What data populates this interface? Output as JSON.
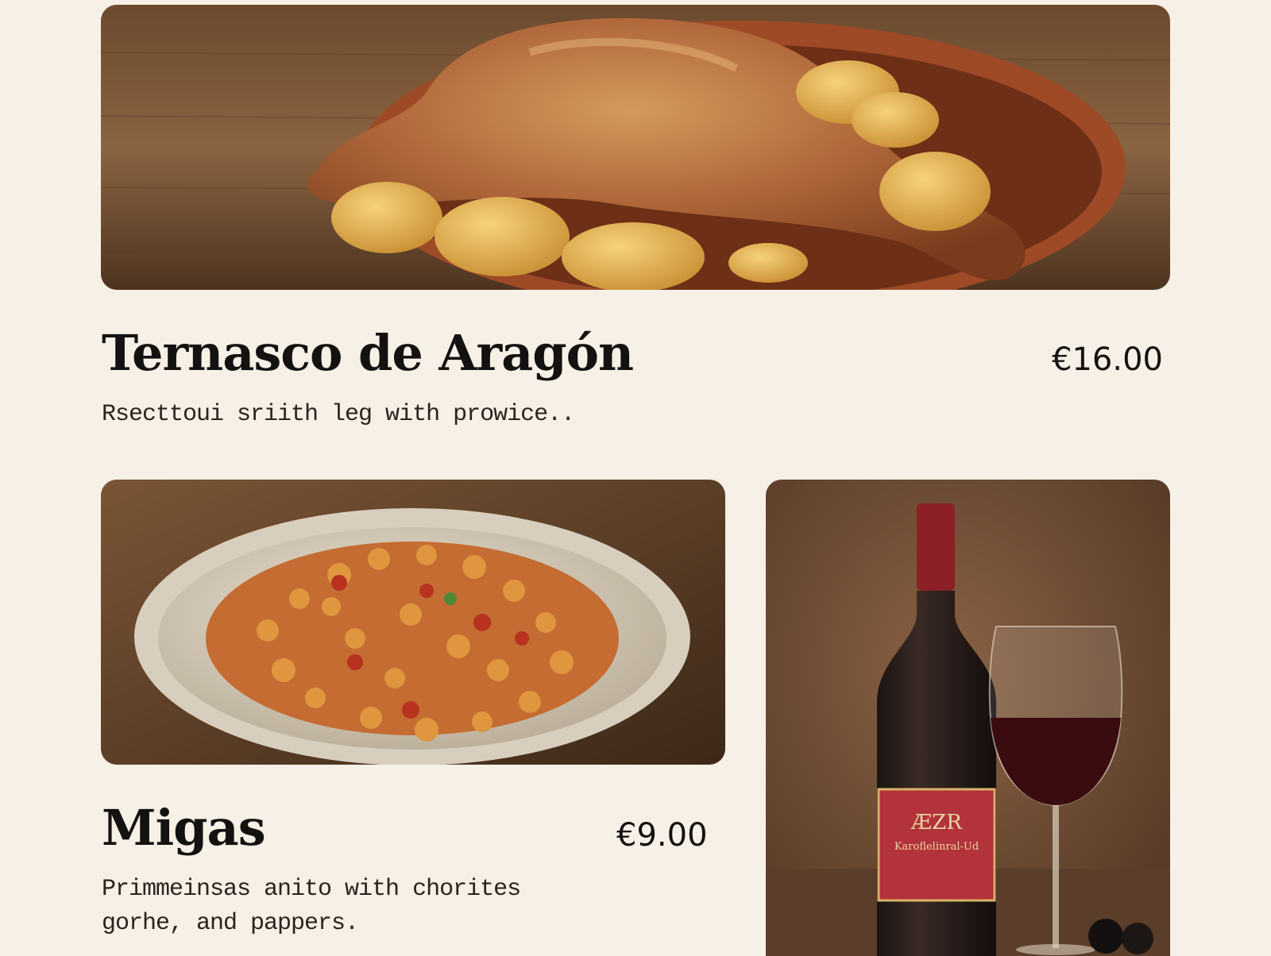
{
  "dishes": [
    {
      "title": "Ternasco de Aragón",
      "price": "€16.00",
      "description": "Rsecttoui sriith leg with prowice..",
      "image": "roast-lamb-leg-with-potatoes-photo"
    },
    {
      "title": "Migas",
      "price": "€9.00",
      "description": "Primmeinsas anito with chorites\ngorhe, and pappers.",
      "image": "migas-breadcrumbs-plate-photo"
    }
  ],
  "wine": {
    "image": "red-wine-bottle-and-glass-photo",
    "label_text": "Karoflelinral-Ud"
  },
  "colors": {
    "background": "#f7f0e6",
    "text": "#141210",
    "wine_label": "#b3333a"
  }
}
